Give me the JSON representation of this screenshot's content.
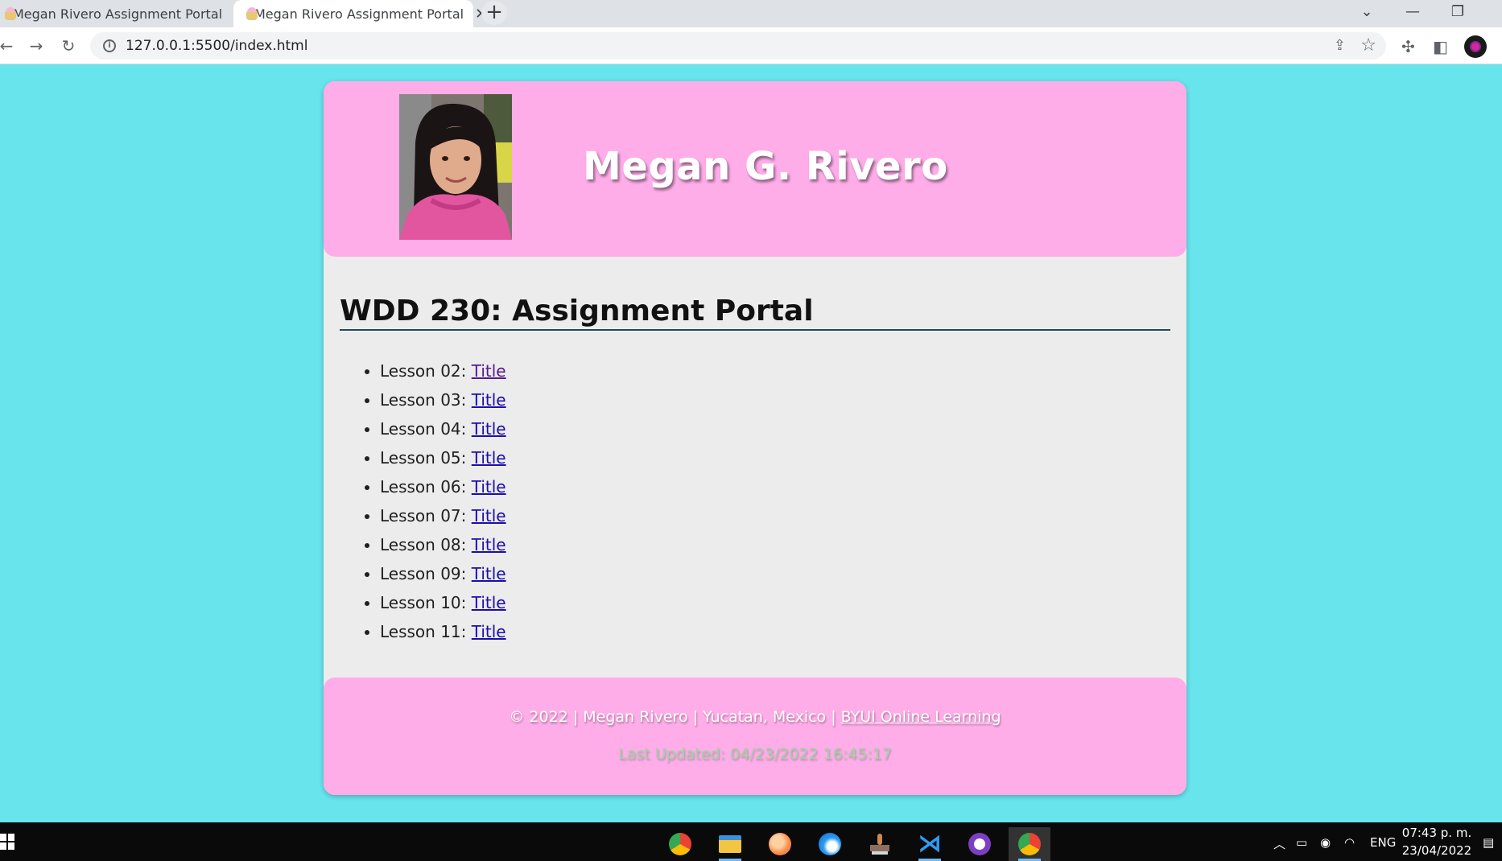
{
  "browser": {
    "tabs": [
      {
        "title": "Megan Rivero Assignment Portal",
        "active": false
      },
      {
        "title": "Megan Rivero Assignment Portal",
        "active": true
      }
    ],
    "new_tab_glyph": "+",
    "url": "127.0.0.1:5500/index.html"
  },
  "header": {
    "name": "Megan G. Rivero",
    "photo_alt": "Megan G. Rivero"
  },
  "main": {
    "title": "WDD 230: Assignment Portal",
    "lessons": [
      {
        "label": "Lesson 02: ",
        "link": "Title"
      },
      {
        "label": "Lesson 03: ",
        "link": "Title"
      },
      {
        "label": "Lesson 04: ",
        "link": "Title"
      },
      {
        "label": "Lesson 05: ",
        "link": "Title"
      },
      {
        "label": "Lesson 06: ",
        "link": "Title"
      },
      {
        "label": "Lesson 07: ",
        "link": "Title"
      },
      {
        "label": "Lesson 08: ",
        "link": "Title"
      },
      {
        "label": "Lesson 09: ",
        "link": "Title"
      },
      {
        "label": "Lesson 10: ",
        "link": "Title"
      },
      {
        "label": "Lesson 11: ",
        "link": "Title"
      }
    ]
  },
  "footer": {
    "copyright": "© 2022 | Megan Rivero | Yucatan, Mexico | ",
    "link": "BYUI Online Learning",
    "last_updated": "Last Updated: 04/23/2022 16:45:17"
  },
  "taskbar": {
    "language": "ENG",
    "time": "07:43 p. m.",
    "date": "23/04/2022"
  },
  "colors": {
    "background": "#67e4ec",
    "header_footer": "#feade8",
    "content": "#ececec",
    "link": "#1a0dab",
    "link_visited": "#551a8b"
  }
}
